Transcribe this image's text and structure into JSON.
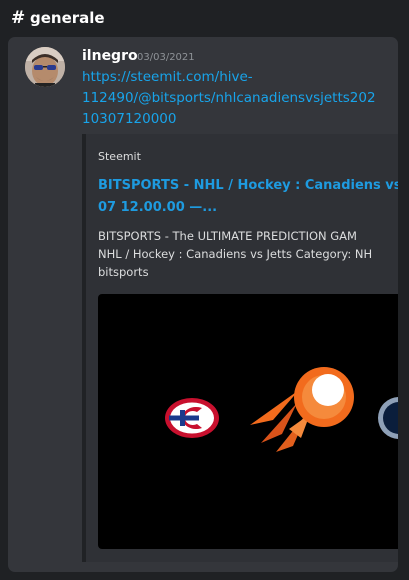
{
  "channel": {
    "hash": "#",
    "name": "generale"
  },
  "message": {
    "username": "ilnegro",
    "timestamp": "03/03/2021",
    "link_lines": [
      "https://steemit.com/hive-",
      "112490/@bitsports/nhlcanadiensvsjetts202",
      "10307120000"
    ]
  },
  "embed": {
    "provider": "Steemit",
    "title_lines": [
      "BITSPORTS - NHL / Hockey : Canadiens vs",
      "07 12.00.00 —..."
    ],
    "description_lines": [
      "BITSPORTS - The ULTIMATE PREDICTION GAM",
      "NHL / Hockey : Canadiens vs Jetts Category: NH",
      "bitsports"
    ],
    "image_icons": [
      "canadiens-logo-icon",
      "comet-logo-icon",
      "jetts-logo-icon"
    ]
  },
  "colors": {
    "background": "#1f2124",
    "card": "#34363b",
    "embed": "#2f3136",
    "link": "#18a4ea",
    "comet_orange": "#f26b1d"
  }
}
